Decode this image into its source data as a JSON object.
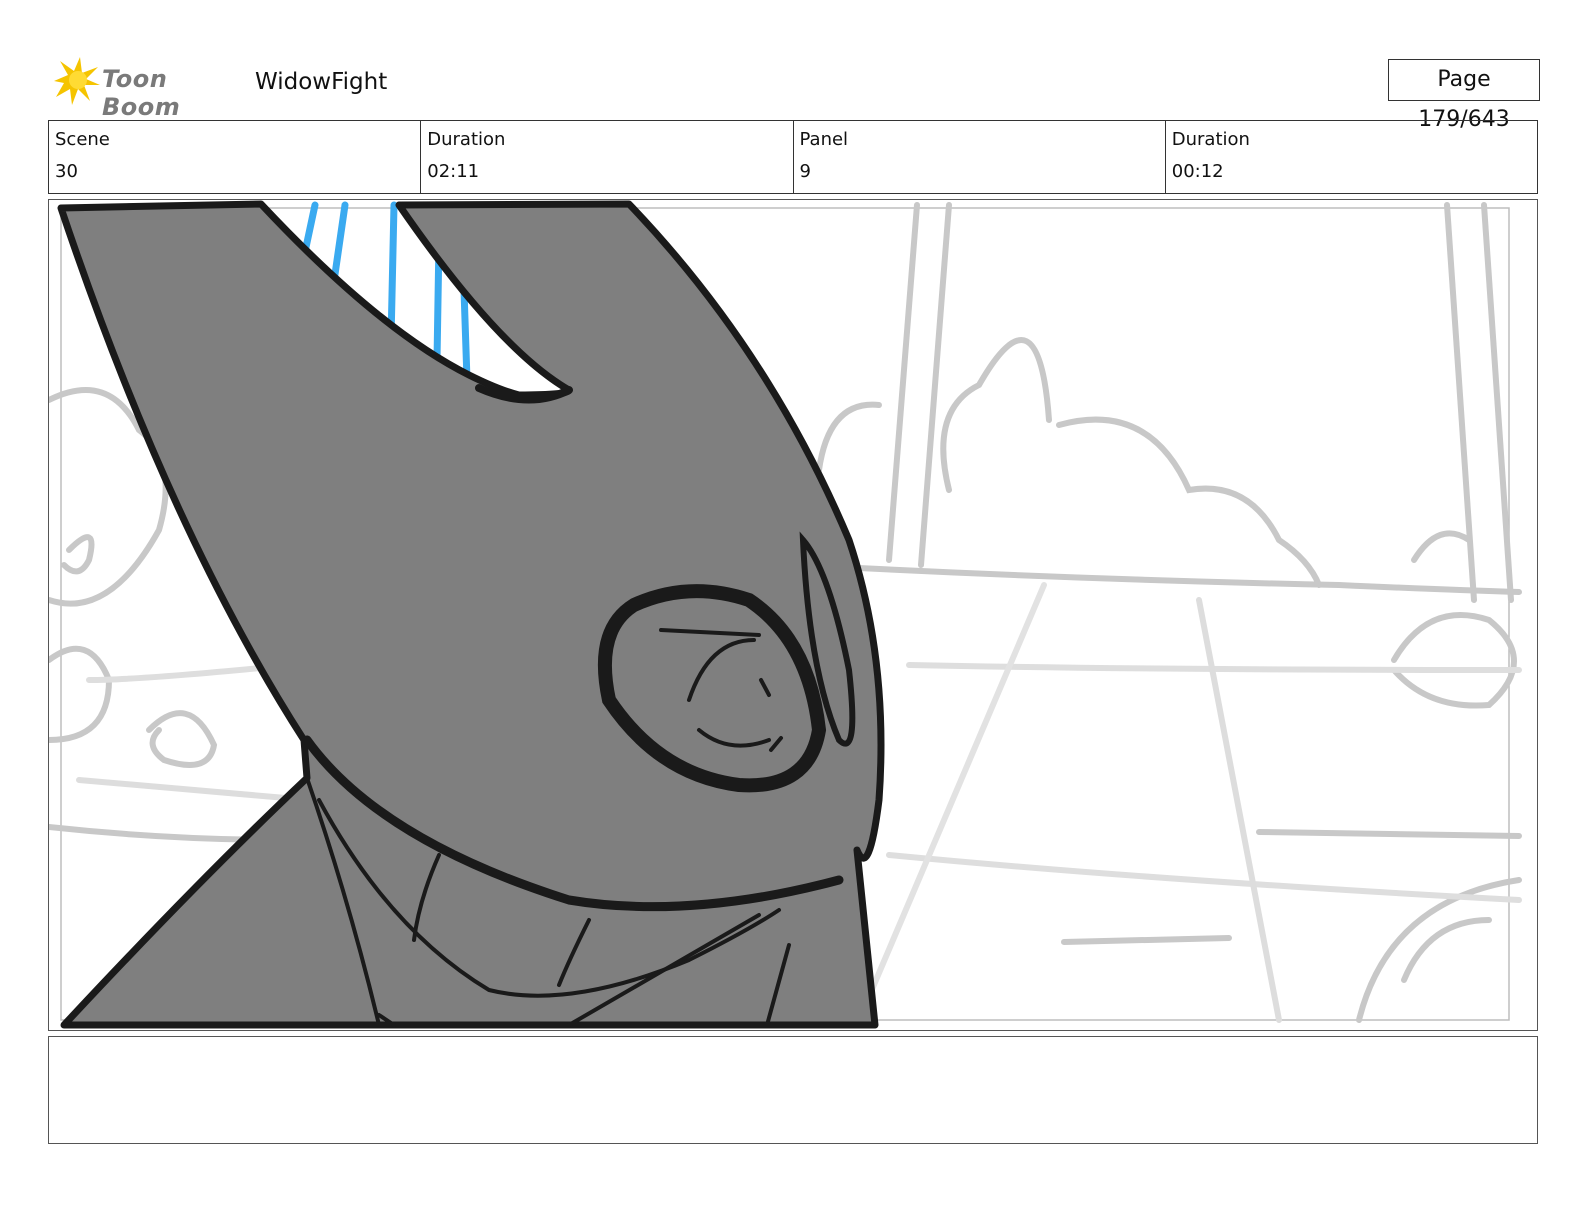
{
  "header": {
    "logo_text": "Toon Boom",
    "project_title": "WidowFight",
    "page_label": "Page 179/643"
  },
  "info": {
    "scene_label": "Scene",
    "scene_value": "30",
    "scene_duration_label": "Duration",
    "scene_duration_value": "02:11",
    "panel_label": "Panel",
    "panel_value": "9",
    "panel_duration_label": "Duration",
    "panel_duration_value": "00:12"
  },
  "notes": {
    "text": ""
  },
  "colors": {
    "logo_yellow": "#f5c400",
    "character_fill": "#7f7f7f",
    "outline": "#1a1a1a",
    "background_lines": "#c8c8c8",
    "accent_blue": "#3aaaf0"
  }
}
